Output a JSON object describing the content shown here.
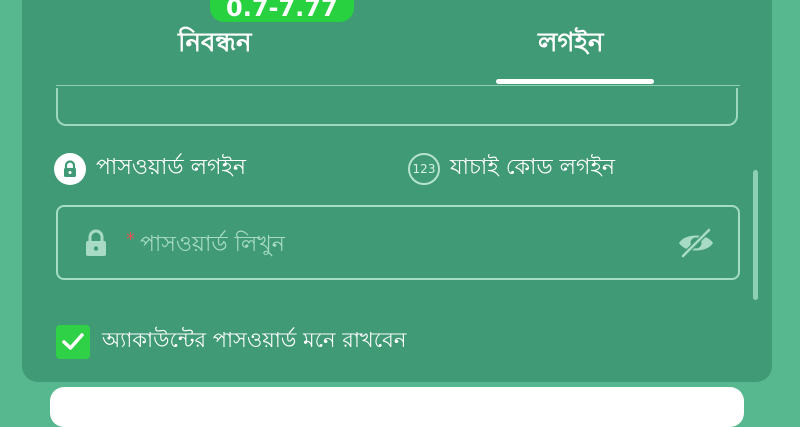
{
  "tabs": {
    "register_label": "নিবন্ধন",
    "login_label": "লগইন",
    "version_badge": "0.7-7.77"
  },
  "login_methods": {
    "password_label": "পাসওয়ার্ড লগইন",
    "code_label": "যাচাই কোড লগইন",
    "code_icon_text": "123"
  },
  "password_field": {
    "required_mark": "*",
    "placeholder": "পাসওয়ার্ড লিখুন",
    "value": ""
  },
  "remember": {
    "label": "অ্যাকাউন্টের পাসওয়ার্ড মনে রাখবেন",
    "checked": true
  },
  "icons": {
    "lock": "lock-icon",
    "eye_off": "eye-off-icon",
    "checkmark": "checkmark-icon"
  },
  "colors": {
    "background": "#57b890",
    "card": "#3f9a75",
    "badge": "#27d13f",
    "checkbox": "#2fd147",
    "required": "#e05555"
  }
}
